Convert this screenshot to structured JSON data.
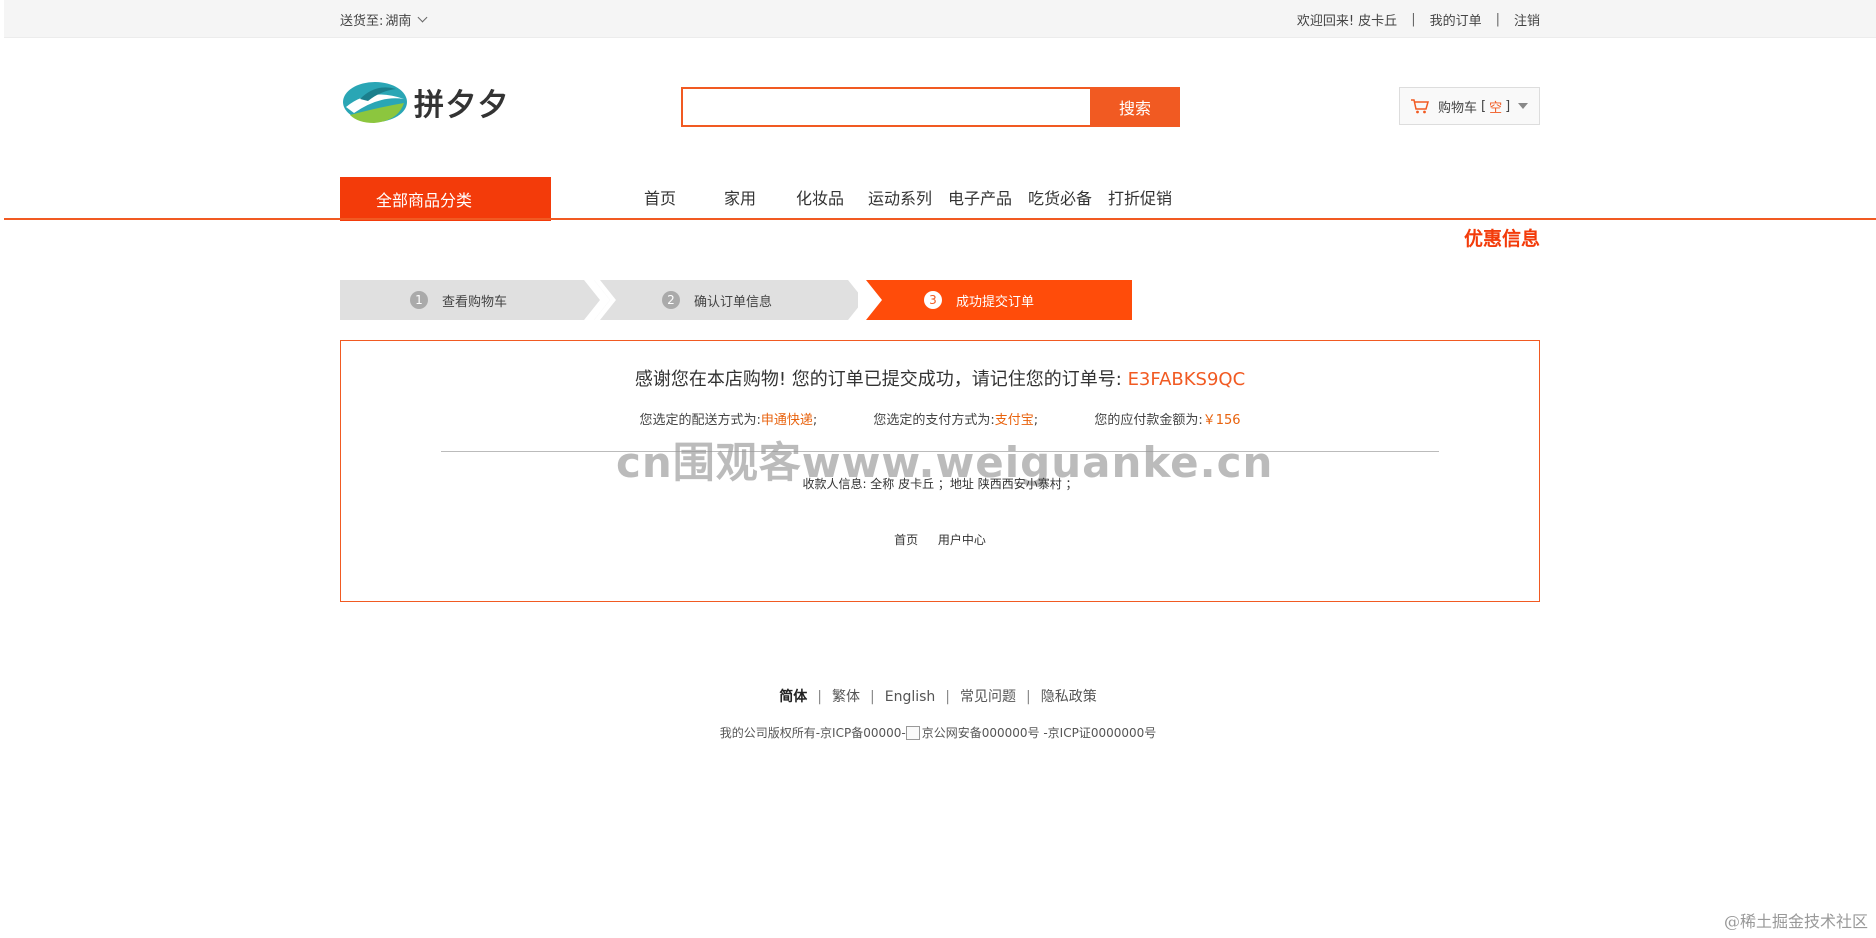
{
  "topbar": {
    "ship_to_label": "送货至:",
    "region": "湖南",
    "welcome": "欢迎回来! 皮卡丘",
    "sep": "|",
    "my_orders": "我的订单",
    "logout": "注销"
  },
  "header": {
    "logo_text": "拼夕夕",
    "search_placeholder": "",
    "search_button": "搜索",
    "cart_label": "购物车",
    "cart_bracket_open": "[",
    "cart_status": "空",
    "cart_bracket_close": "]"
  },
  "nav": {
    "all_categories": "全部商品分类",
    "items": [
      "首页",
      "家用",
      "化妆品",
      "运动系列",
      "电子产品",
      "吃货必备",
      "打折促销"
    ],
    "promo": "优惠信息"
  },
  "steps": [
    {
      "num": "1",
      "label": "查看购物车"
    },
    {
      "num": "2",
      "label": "确认订单信息"
    },
    {
      "num": "3",
      "label": "成功提交订单"
    }
  ],
  "order": {
    "thanks_text": "感谢您在本店购物! 您的订单已提交成功，请记住您的订单号:",
    "order_no": "E3FABKS9QC",
    "shipping_label": "您选定的配送方式为:",
    "shipping_value": "申通快递",
    "payment_label": "您选定的支付方式为:",
    "payment_value": "支付宝",
    "amount_label": "您的应付款金额为:",
    "amount_value": "￥156",
    "semicolon": ";",
    "watermark": "cn围观客www.weiguanke.cn",
    "receiver": "收款人信息: 全称 皮卡丘 ；地址 陕西西安小寨村 ；",
    "link_home": "首页",
    "link_user_center": "用户中心"
  },
  "footer": {
    "langs": [
      "简体",
      "繁体",
      "English",
      "常见问题",
      "隐私政策"
    ],
    "sep": "|",
    "copyright_left": "我的公司版权所有-京ICP备00000-",
    "copyright_right": "京公网安备000000号 -京ICP证0000000号"
  },
  "corner_mark": "@稀土掘金技术社区",
  "colors": {
    "accent": "#f15a22",
    "nav_red": "#f33b0a",
    "step_gray": "#e0e0e0"
  }
}
